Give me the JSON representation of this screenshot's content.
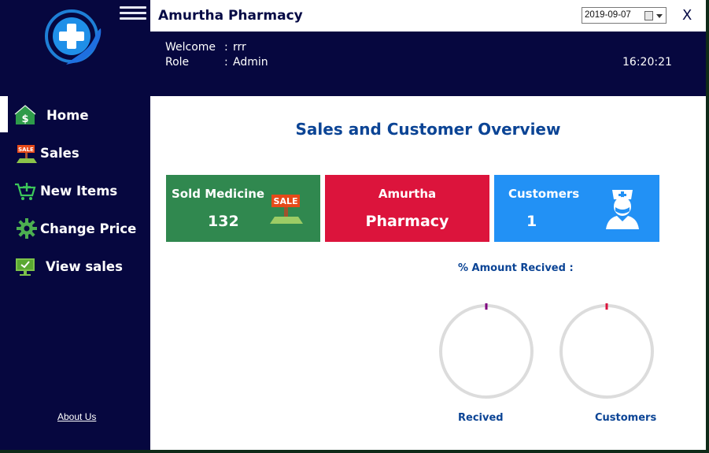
{
  "header": {
    "app_title": "Amurtha Pharmacy",
    "date": "2019-09-07",
    "close_label": "X",
    "welcome_label": "Welcome",
    "welcome_value": "rrr",
    "role_label": "Role",
    "role_value": "Admin",
    "separator": ":",
    "clock": "16:20:21"
  },
  "sidebar": {
    "items": [
      {
        "label": "Home",
        "icon": "home-dollar-icon"
      },
      {
        "label": "Sales",
        "icon": "sale-sign-icon"
      },
      {
        "label": "New Items",
        "icon": "cart-add-icon"
      },
      {
        "label": "Change Price",
        "icon": "gear-icon"
      },
      {
        "label": "View sales",
        "icon": "monitor-check-icon"
      }
    ],
    "about": "About Us"
  },
  "main": {
    "title": "Sales and Customer Overview",
    "cards": {
      "sold": {
        "title": "Sold Medicine",
        "value": "132",
        "color": "#30884f"
      },
      "pharmacy": {
        "title": "Amurtha",
        "subtitle": "Pharmacy",
        "color": "#dc143c"
      },
      "customers": {
        "title": "Customers",
        "value": "1",
        "color": "#2291f5"
      }
    },
    "amount_label": "% Amount Recived :",
    "gauges": [
      {
        "label": "Recived",
        "indicator_color": "#800080"
      },
      {
        "label": "Customers",
        "indicator_color": "#dc143c"
      }
    ]
  },
  "colors": {
    "navy": "#06073f",
    "accent_blue": "#0b4495"
  }
}
